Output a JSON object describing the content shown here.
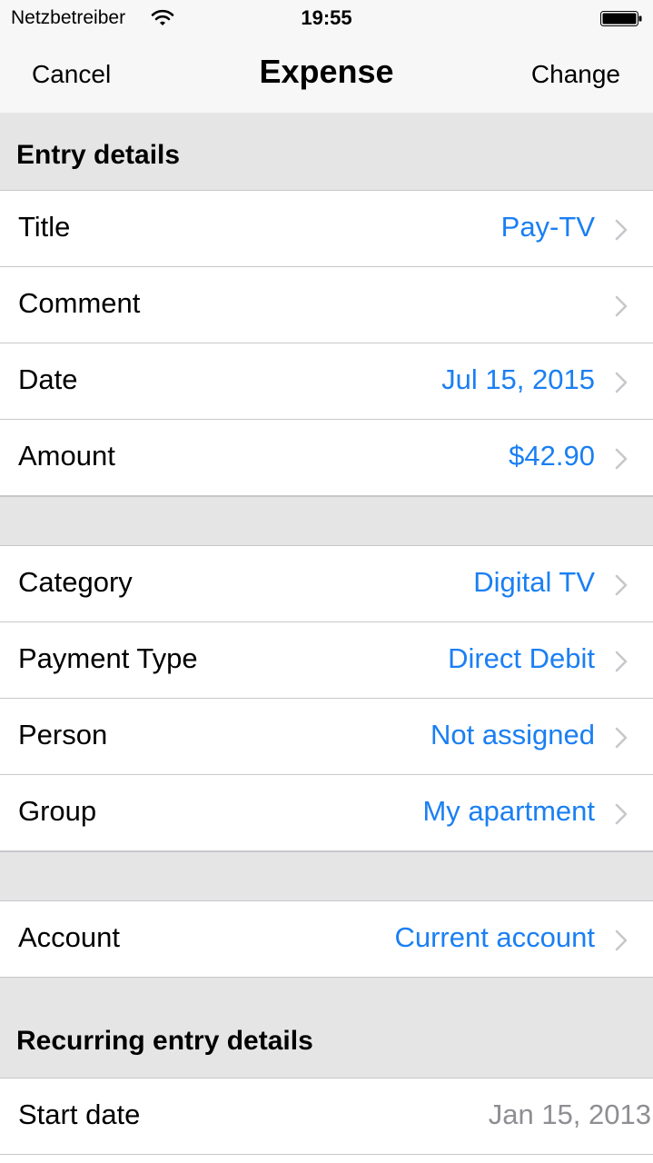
{
  "status": {
    "carrier": "Netzbetreiber",
    "time": "19:55",
    "wifi_icon": "wifi-icon",
    "battery_icon": "battery-icon"
  },
  "nav": {
    "cancel": "Cancel",
    "title": "Expense",
    "change": "Change"
  },
  "sections": {
    "entry_details": "Entry details",
    "recurring_details": "Recurring entry details"
  },
  "rows": {
    "title": {
      "label": "Title",
      "value": "Pay-TV"
    },
    "comment": {
      "label": "Comment",
      "value": ""
    },
    "date": {
      "label": "Date",
      "value": "Jul 15, 2015"
    },
    "amount": {
      "label": "Amount",
      "value": "$42.90"
    },
    "category": {
      "label": "Category",
      "value": "Digital TV"
    },
    "payment_type": {
      "label": "Payment Type",
      "value": "Direct Debit"
    },
    "person": {
      "label": "Person",
      "value": "Not assigned"
    },
    "group": {
      "label": "Group",
      "value": "My apartment"
    },
    "account": {
      "label": "Account",
      "value": "Current account"
    },
    "start_date": {
      "label": "Start date",
      "value": "Jan 15, 2013"
    }
  },
  "colors": {
    "accent": "#1a7ff3",
    "disabled_value": "#8e8e93",
    "group_background": "#e5e5e5"
  }
}
